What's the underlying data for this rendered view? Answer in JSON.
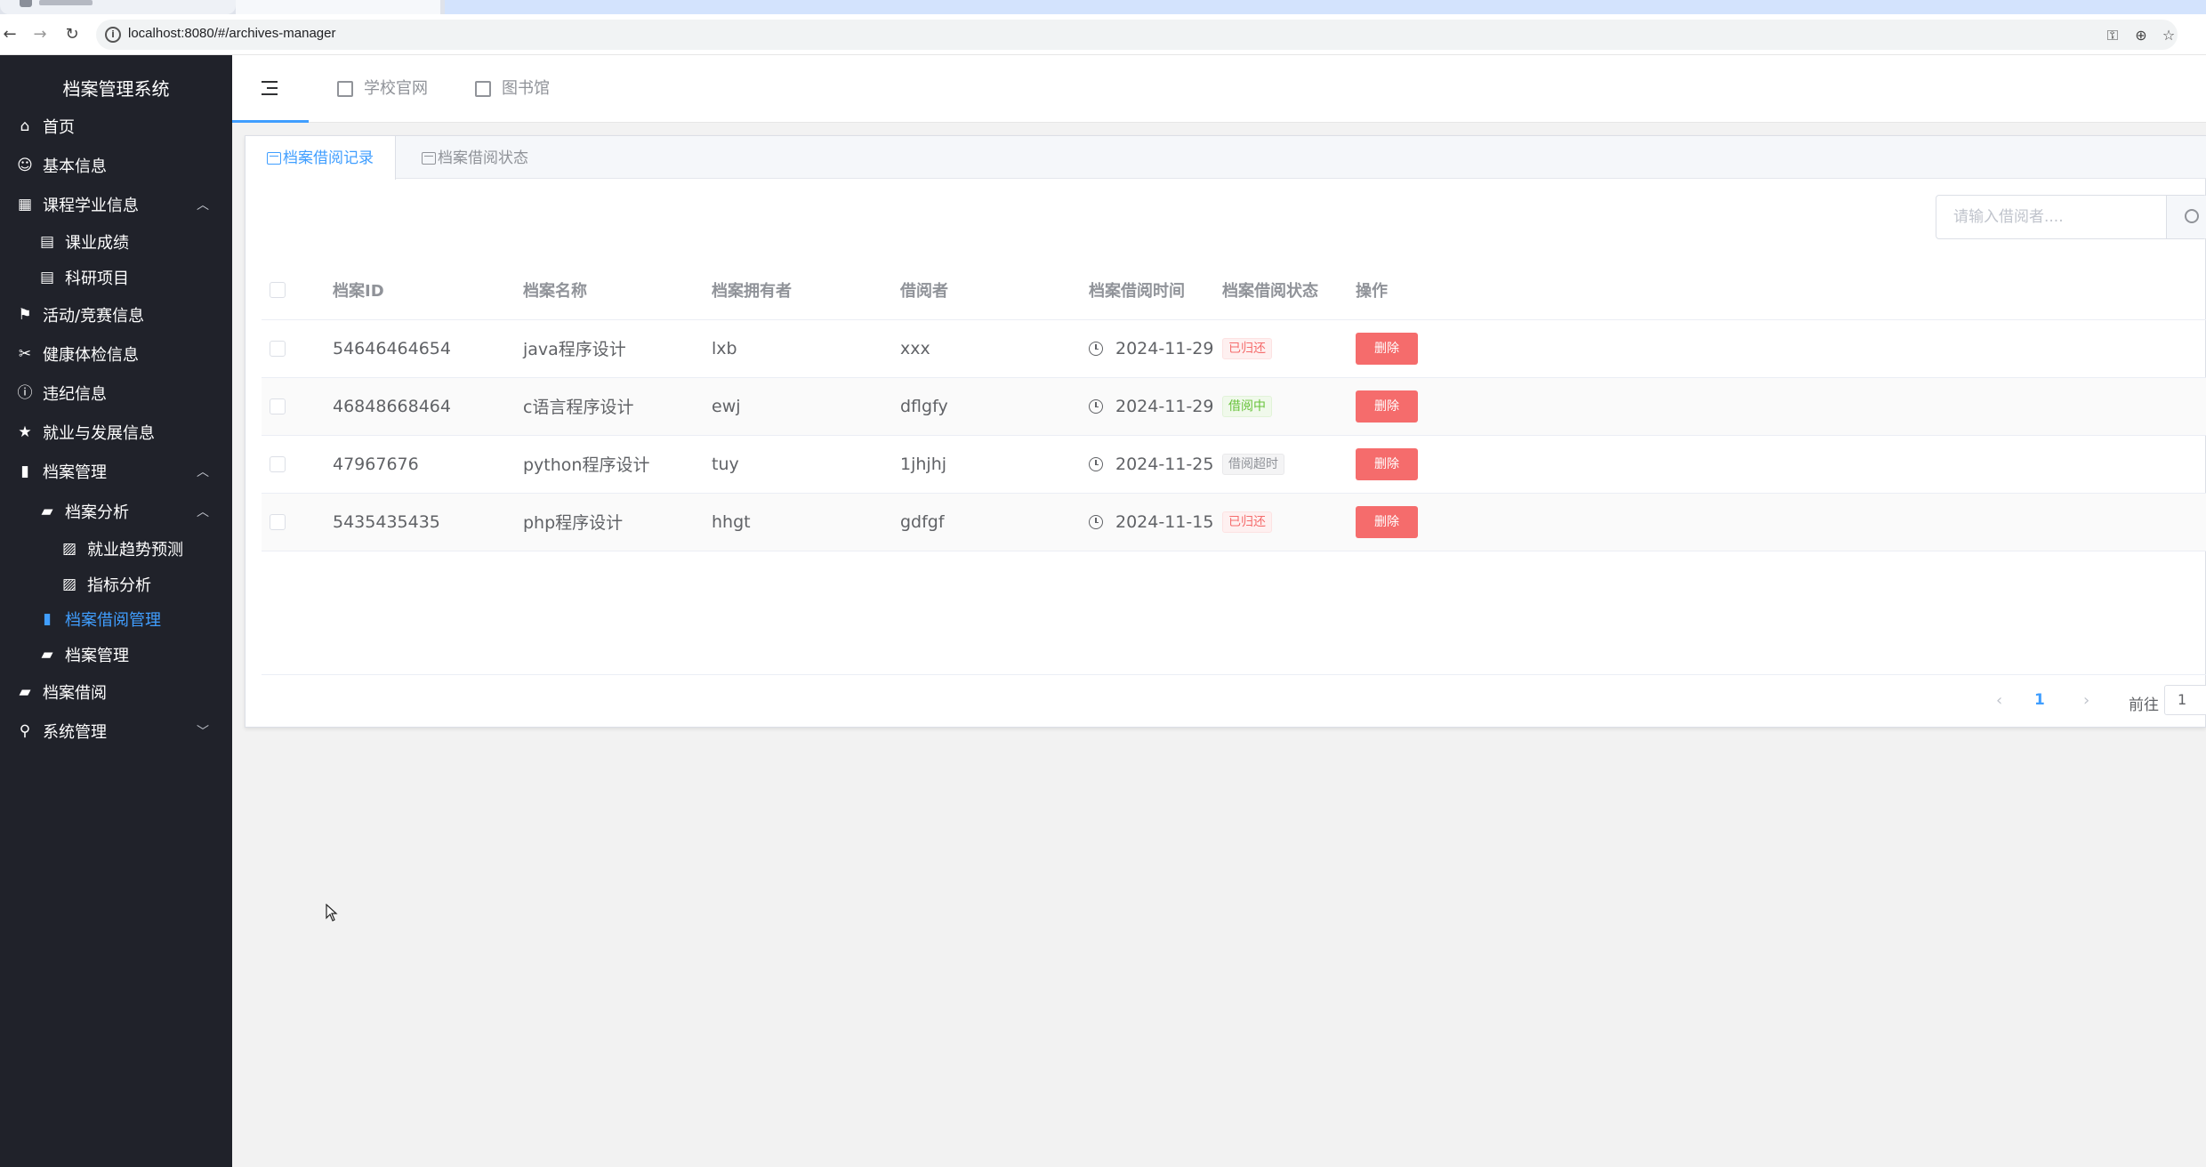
{
  "browser": {
    "url": "localhost:8080/#/archives-manager"
  },
  "sidebar": {
    "title": "档案管理系统",
    "items": [
      {
        "label": "首页",
        "icon": "home-icon",
        "level": 1
      },
      {
        "label": "基本信息",
        "icon": "user-icon",
        "level": 1
      },
      {
        "label": "课程学业信息",
        "icon": "grid-icon",
        "level": 1,
        "expanded": true
      },
      {
        "label": "课业成绩",
        "icon": "document-icon",
        "level": 2
      },
      {
        "label": "科研项目",
        "icon": "document-icon",
        "level": 2
      },
      {
        "label": "活动/竞赛信息",
        "icon": "flag-icon",
        "level": 1
      },
      {
        "label": "健康体检信息",
        "icon": "scissors-icon",
        "level": 1
      },
      {
        "label": "违纪信息",
        "icon": "info-icon",
        "level": 1
      },
      {
        "label": "就业与发展信息",
        "icon": "star-icon",
        "level": 1
      },
      {
        "label": "档案管理",
        "icon": "notebook-icon",
        "level": 1,
        "expanded": true
      },
      {
        "label": "档案分析",
        "icon": "wallet-icon",
        "level": 2,
        "expanded": true
      },
      {
        "label": "就业趋势预测",
        "icon": "chart-icon",
        "level": 3
      },
      {
        "label": "指标分析",
        "icon": "chart-icon",
        "level": 3
      },
      {
        "label": "档案借阅管理",
        "icon": "notebook-icon",
        "level": 2,
        "active": true
      },
      {
        "label": "档案管理",
        "icon": "wallet-icon",
        "level": 2
      },
      {
        "label": "档案借阅",
        "icon": "wallet-icon",
        "level": 1
      },
      {
        "label": "系统管理",
        "icon": "location-icon",
        "level": 1,
        "collapsed": true
      }
    ]
  },
  "header": {
    "links": [
      {
        "label": "学校官网",
        "icon": "building-icon"
      },
      {
        "label": "图书馆",
        "icon": "copy-icon"
      }
    ]
  },
  "tabs": [
    {
      "label": "档案借阅记录",
      "active": true
    },
    {
      "label": "档案借阅状态",
      "active": false
    }
  ],
  "search": {
    "placeholder": "请输入借阅者...."
  },
  "table": {
    "columns": [
      "档案ID",
      "档案名称",
      "档案拥有者",
      "借阅者",
      "档案借阅时间",
      "档案借阅状态",
      "操作"
    ],
    "rows": [
      {
        "id": "54646464654",
        "name": "java程序设计",
        "owner": "lxb",
        "borrower": "xxx",
        "time": "2024-11-29",
        "status": "已归还",
        "status_type": "danger",
        "action": "删除"
      },
      {
        "id": "46848668464",
        "name": "c语言程序设计",
        "owner": "ewj",
        "borrower": "dflgfy",
        "time": "2024-11-29",
        "status": "借阅中",
        "status_type": "success",
        "action": "删除"
      },
      {
        "id": "47967676",
        "name": "python程序设计",
        "owner": "tuy",
        "borrower": "1jhjhj",
        "time": "2024-11-25",
        "status": "借阅超时",
        "status_type": "info",
        "action": "删除"
      },
      {
        "id": "5435435435",
        "name": "php程序设计",
        "owner": "hhgt",
        "borrower": "gdfgf",
        "time": "2024-11-15",
        "status": "已归还",
        "status_type": "danger",
        "action": "删除"
      }
    ]
  },
  "pagination": {
    "current_page": "1",
    "goto_label": "前往",
    "goto_value": "1"
  },
  "colors": {
    "sidebar_bg": "#20222a",
    "accent": "#409eff",
    "danger": "#f56c6c",
    "success": "#67c23a",
    "info": "#909399"
  }
}
